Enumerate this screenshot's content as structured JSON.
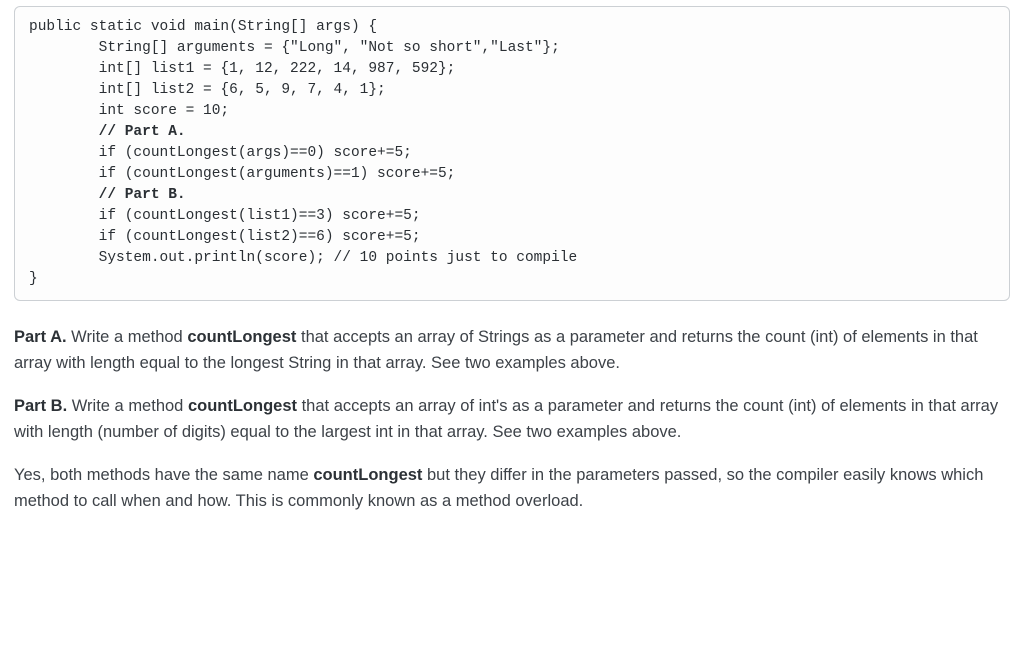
{
  "code": {
    "l1": "public static void main(String[] args) {",
    "l2": "        String[] arguments = {\"Long\", \"Not so short\",\"Last\"};",
    "l3": "        int[] list1 = {1, 12, 222, 14, 987, 592};",
    "l4": "        int[] list2 = {6, 5, 9, 7, 4, 1};",
    "l5": "        int score = 10;",
    "l6": "        // Part A.",
    "l7": "        if (countLongest(args)==0) score+=5;",
    "l8": "        if (countLongest(arguments)==1) score+=5;",
    "l9": "        // Part B.",
    "l10": "        if (countLongest(list1)==3) score+=5;",
    "l11": "        if (countLongest(list2)==6) score+=5;",
    "l12": "        System.out.println(score); // 10 points just to compile",
    "l13": "}"
  },
  "partA": {
    "label": "Part A.",
    "text1": " Write a method ",
    "method": "countLongest",
    "text2": " that accepts an array of Strings as a parameter and returns the count (int) of elements in that array with length equal to the longest String in that array.  See two examples above."
  },
  "partB": {
    "label": "Part B.",
    "text1": " Write a method ",
    "method": "countLongest",
    "text2": " that accepts an array of int's as a parameter and returns the count (int) of elements in that array with length (number of digits) equal to the largest int in that array.  See two examples above."
  },
  "overload": {
    "text1": "Yes, both methods have the same name ",
    "method": "countLongest",
    "text2": " but they differ in the parameters passed, so the compiler easily knows which method to call when and how.  This is commonly known as a method overload."
  }
}
